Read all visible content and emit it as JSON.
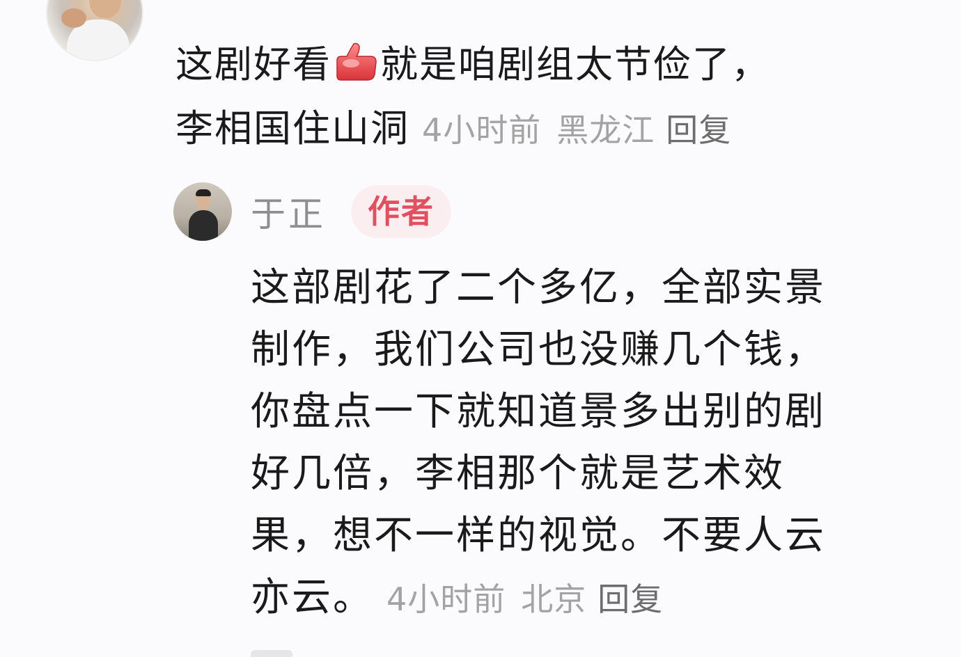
{
  "top_comment": {
    "lines": [
      "这剧好看",
      "就是咱剧组太节俭了，",
      "李相国住山洞"
    ],
    "time": "4小时前",
    "location": "黑龙江",
    "reply_label": "回复",
    "thumb_icon": "thumbs-up-icon"
  },
  "author_reply": {
    "name": "于正",
    "badge": "作者",
    "lines": [
      "这部剧花了二个多亿，全部实景",
      "制作，我们公司也没赚几个钱，",
      "你盘点一下就知道景多出别的剧",
      "好几倍，李相那个就是艺术效",
      "果，想不一样的视觉。不要人云",
      "亦云。"
    ],
    "time": "4小时前",
    "location": "北京",
    "reply_label": "回复"
  },
  "colors": {
    "badge_bg": "#fbeef0",
    "badge_text": "#e0505f",
    "meta_text": "#a3a3a3",
    "body_text": "#1a1a1a"
  }
}
